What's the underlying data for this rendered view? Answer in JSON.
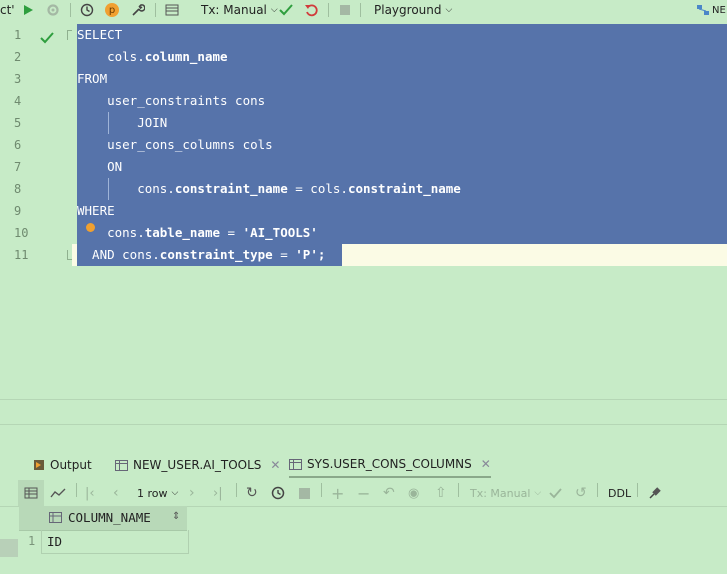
{
  "toolbar": {
    "ct_label": "ct'",
    "tx_mode": "Tx: Manual",
    "playground": "Playground",
    "ne_label": "NE",
    "p_badge": "p"
  },
  "editor": {
    "line_numbers": [
      "1",
      "2",
      "3",
      "4",
      "5",
      "6",
      "7",
      "8",
      "9",
      "10",
      "11"
    ],
    "lines": [
      {
        "a": "SELECT",
        "b": "",
        "c": "",
        "d": ""
      },
      {
        "a": "    cols.",
        "b": "column_name",
        "c": "",
        "d": ""
      },
      {
        "a": "FROM",
        "b": "",
        "c": "",
        "d": ""
      },
      {
        "a": "    user_constraints cons",
        "b": "",
        "c": "",
        "d": ""
      },
      {
        "a": "        JOIN",
        "b": "",
        "c": "",
        "d": ""
      },
      {
        "a": "    user_cons_columns cols",
        "b": "",
        "c": "",
        "d": ""
      },
      {
        "a": "    ON",
        "b": "",
        "c": "",
        "d": ""
      },
      {
        "a": "        cons.",
        "b": "constraint_name",
        "c": " = cols.",
        "d": "constraint_name"
      },
      {
        "a": "WHERE",
        "b": "",
        "c": "",
        "d": ""
      },
      {
        "a": "    cons.",
        "b": "table_name",
        "c": " = ",
        "d": "'AI_TOOLS'"
      },
      {
        "a": "  AND cons.",
        "b": "constraint_type",
        "c": " = ",
        "d": "'P';"
      }
    ]
  },
  "results": {
    "tabs": [
      {
        "label": "Output"
      },
      {
        "label": "NEW_USER.AI_TOOLS"
      },
      {
        "label": "SYS.USER_CONS_COLUMNS"
      }
    ],
    "row_count": "1 row",
    "tx_mode": "Tx: Manual",
    "ddl": "DDL",
    "column_header": "COLUMN_NAME",
    "row_number": "1",
    "cell_value": "ID"
  },
  "colors": {
    "background": "#c7ebc7",
    "selection": "#5673aa",
    "current_line": "#fbfbe5",
    "run_green": "#2e9e3e",
    "revert_red": "#d13b3b",
    "badge_orange": "#f0a030"
  }
}
